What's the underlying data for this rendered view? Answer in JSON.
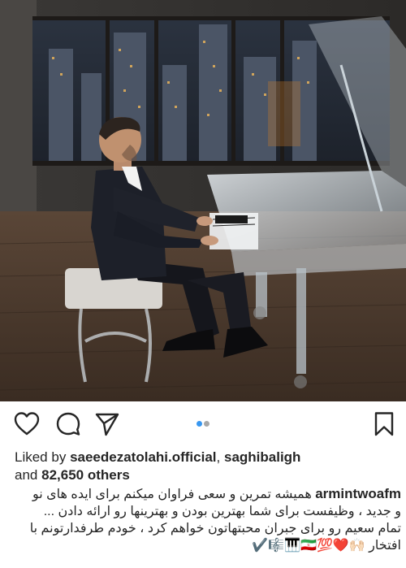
{
  "post": {
    "likes_prefix": "Liked by",
    "liked_by_users": [
      "saeedezatolahi.official",
      "saghibaligh"
    ],
    "likes_separator": ",",
    "likes_and": "and",
    "likes_count": "82,650 others",
    "caption_username": "armintwoafm",
    "caption_lines": [
      "همیشه تمرین و سعی فراوان میکنم برای ایده های نو",
      "و جدید ، وظیفست برای شما بهترین بودن و بهترینها رو ارائه دادن ...",
      "تمام سعیم رو برای جبران محبتهاتون خواهم کرد ، خودم طرفدارتونم با",
      "افتخار 🙌🏻❤️💯🇮🇷🎹🎼✔️"
    ]
  },
  "carousel": {
    "total": 2,
    "active_index": 0
  },
  "colors": {
    "accent_dot": "#3897f0",
    "text": "#262626"
  },
  "icons": {
    "like": "heart-outline-icon",
    "comment": "speech-bubble-icon",
    "share": "paper-plane-icon",
    "save": "bookmark-icon"
  }
}
